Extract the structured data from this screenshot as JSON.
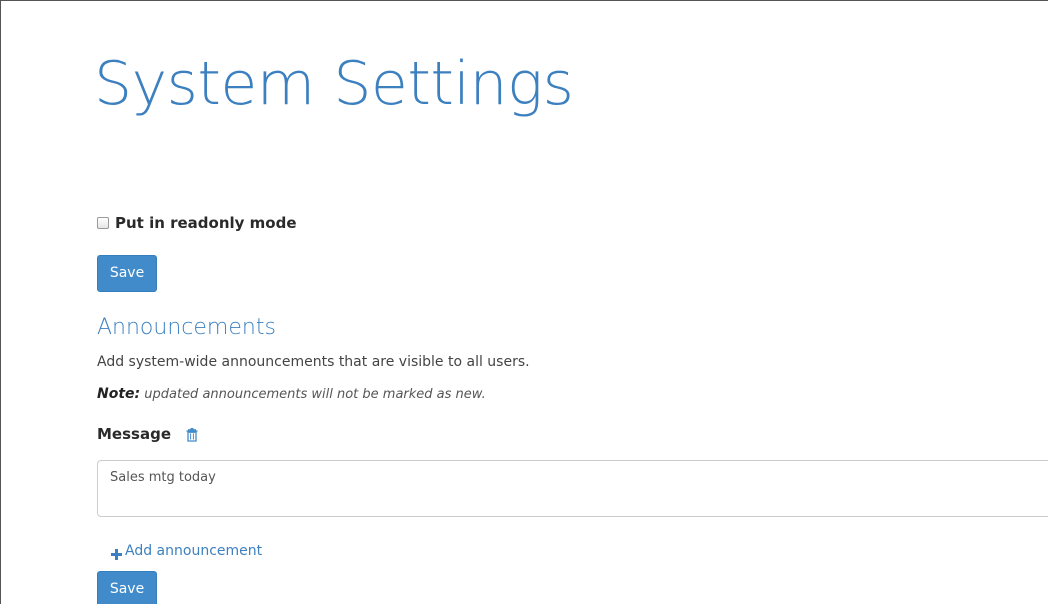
{
  "page": {
    "title": "System Settings"
  },
  "readonly": {
    "label": "Put in readonly mode",
    "checked": false,
    "save_label": "Save"
  },
  "announcements": {
    "title": "Announcements",
    "description": "Add system-wide announcements that are visible to all users.",
    "note_prefix": "Note:",
    "note_text": " updated announcements will not be marked as new.",
    "message_label": "Message",
    "messages": [
      {
        "value": "Sales mtg today"
      }
    ],
    "add_label": "Add announcement",
    "save_label": "Save"
  },
  "icons": {
    "delete": "trash-icon",
    "add": "plus-icon"
  },
  "colors": {
    "primary": "#428bca",
    "heading": "#3d80c0",
    "text": "#333333"
  }
}
